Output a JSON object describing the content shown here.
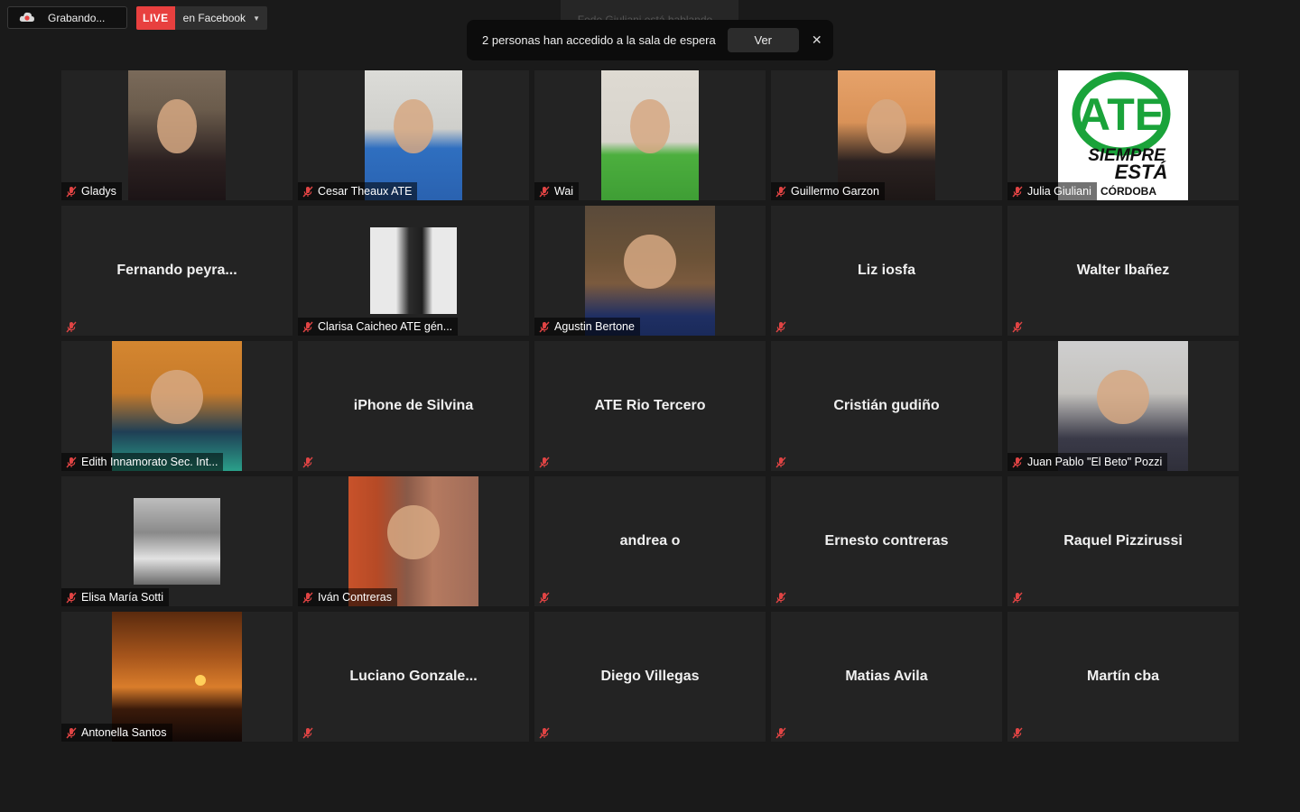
{
  "recording": {
    "label": "Grabando..."
  },
  "live": {
    "badge": "LIVE",
    "destination": "en Facebook"
  },
  "speaking": {
    "text": "Fede Giuliani está hablando..."
  },
  "waiting_notification": {
    "text": "2 personas han accedido a la sala de espera",
    "button": "Ver",
    "close": "✕"
  },
  "participants": [
    {
      "name": "Gladys",
      "video": true
    },
    {
      "name": "Cesar Theaux ATE",
      "video": true
    },
    {
      "name": "Wai",
      "video": true
    },
    {
      "name": "Guillermo Garzon",
      "video": true
    },
    {
      "name": "Julia Giuliani",
      "video": true
    },
    {
      "name": "Fernando  peyra...",
      "video": false
    },
    {
      "name": "Clarisa Caicheo ATE gén...",
      "video": true
    },
    {
      "name": "Agustin Bertone",
      "video": true
    },
    {
      "name": "Liz iosfa",
      "video": false
    },
    {
      "name": "Walter Ibañez",
      "video": false
    },
    {
      "name": "Edith Innamorato Sec. Int...",
      "video": true
    },
    {
      "name": "iPhone de Silvina",
      "video": false
    },
    {
      "name": "ATE Rio Tercero",
      "video": false
    },
    {
      "name": "Cristián gudiño",
      "video": false
    },
    {
      "name": "Juan Pablo \"El Beto\" Pozzi",
      "video": true
    },
    {
      "name": "Elisa María Sotti",
      "video": true
    },
    {
      "name": "Iván Contreras",
      "video": true
    },
    {
      "name": "andrea o",
      "video": false
    },
    {
      "name": "Ernesto contreras",
      "video": false
    },
    {
      "name": "Raquel Pizzirussi",
      "video": false
    },
    {
      "name": "Antonella Santos",
      "video": true
    },
    {
      "name": "Luciano  Gonzale...",
      "video": false
    },
    {
      "name": "Diego Villegas",
      "video": false
    },
    {
      "name": "Matias Avila",
      "video": false
    },
    {
      "name": "Martín cba",
      "video": false
    }
  ],
  "ate_logo": {
    "big": "ATE",
    "line1": "SIEMPRE",
    "line2": "ESTÁ",
    "line3": "CÓRDOBA"
  },
  "colors": {
    "live": "#e8403f",
    "muted_icon": "#e04444",
    "tile_bg": "#232323",
    "ate_green": "#1aa33a"
  }
}
